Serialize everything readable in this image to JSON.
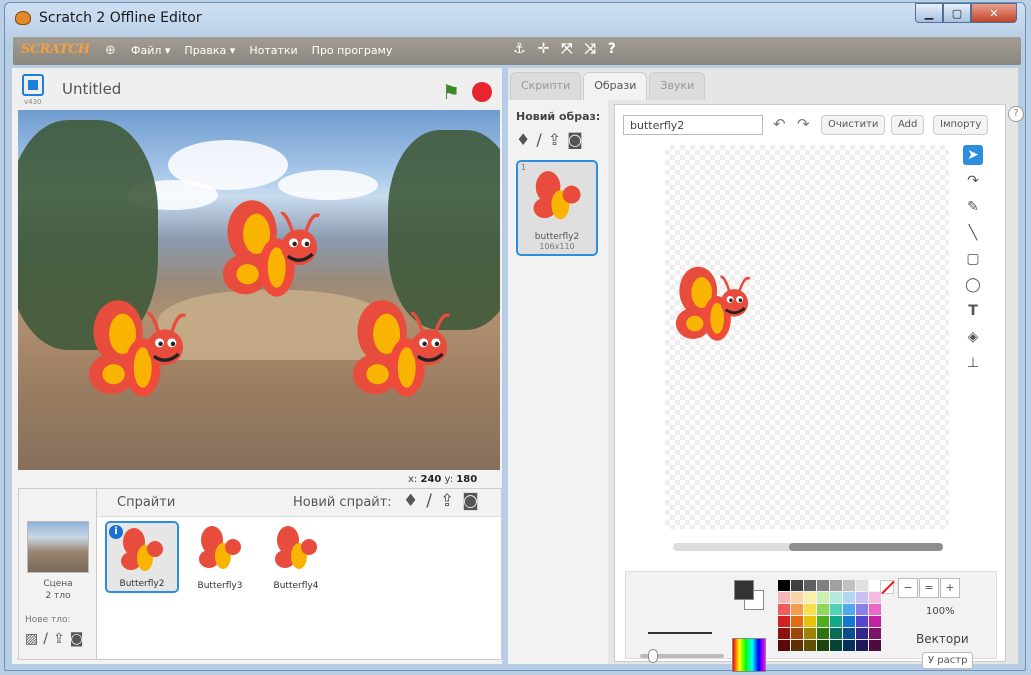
{
  "window": {
    "title": "Scratch 2 Offline Editor",
    "controls": [
      "minimize-icon",
      "maximize-icon",
      "close-icon"
    ]
  },
  "menubar": {
    "logo": "SCRATCH",
    "items": [
      "Файл ▾",
      "Правка ▾",
      "Нотатки",
      "Про програму"
    ],
    "tools": [
      "duplicate-icon",
      "delete-icon",
      "grow-icon",
      "shrink-icon",
      "help-icon"
    ]
  },
  "stage": {
    "version": "v430",
    "project_title": "Untitled",
    "coords_x_label": "x:",
    "coords_x": "240",
    "coords_y_label": "y:",
    "coords_y": "180"
  },
  "scene": {
    "label": "Сцена",
    "backdrops": "2 тло",
    "new_backdrop": "Нове тло:"
  },
  "sprites": {
    "title": "Спрайти",
    "new_sprite": "Новий спрайт:",
    "items": [
      {
        "name": "Butterfly2",
        "selected": true
      },
      {
        "name": "Butterfly3",
        "selected": false
      },
      {
        "name": "Butterfly4",
        "selected": false
      }
    ]
  },
  "tabs": [
    "Скрипти",
    "Образи",
    "Звуки"
  ],
  "active_tab": "Образи",
  "costumes": {
    "new_costume": "Новий образ:",
    "items": [
      {
        "index": "1",
        "name": "butterfly2",
        "size": "106x110"
      }
    ]
  },
  "editor": {
    "costume_name": "butterfly2",
    "clear": "Очистити",
    "add": "Add",
    "import": "Імпорту",
    "zoom": "100%",
    "mode": "Вектори",
    "convert": "У растр",
    "tools": [
      "select-icon",
      "reshape-icon",
      "pencil-icon",
      "line-icon",
      "rectangle-icon",
      "ellipse-icon",
      "text-icon",
      "fill-icon",
      "stamp-icon"
    ]
  },
  "colors": {
    "accent": "#2d8ee0",
    "stop": "#e8242e",
    "flag": "#3a8a2a",
    "palette": [
      "#000000",
      "#404040",
      "#606060",
      "#808080",
      "#a0a0a0",
      "#c0c0c0",
      "#e0e0e0",
      "#ffffff",
      "#f7b7b7",
      "#f9d5a7",
      "#fbf0a9",
      "#c9efb1",
      "#b3ead9",
      "#b1d5f3",
      "#c7c0f1",
      "#f3bde3",
      "#ef5c5c",
      "#f39c4a",
      "#f7e04e",
      "#8ed65a",
      "#4fd2b7",
      "#4fa9ec",
      "#8c7fe8",
      "#e66ac6",
      "#d32020",
      "#e06d12",
      "#e6c30c",
      "#4fae1f",
      "#14a68a",
      "#1478cf",
      "#5646cf",
      "#c022a2",
      "#8f1010",
      "#9c4608",
      "#9c8206",
      "#2f7210",
      "#0b6b59",
      "#0b4c8a",
      "#33268a",
      "#7c1368",
      "#5a0a0a",
      "#603005",
      "#605103",
      "#1c4609",
      "#064438",
      "#063058",
      "#201858",
      "#4d0c40"
    ]
  }
}
